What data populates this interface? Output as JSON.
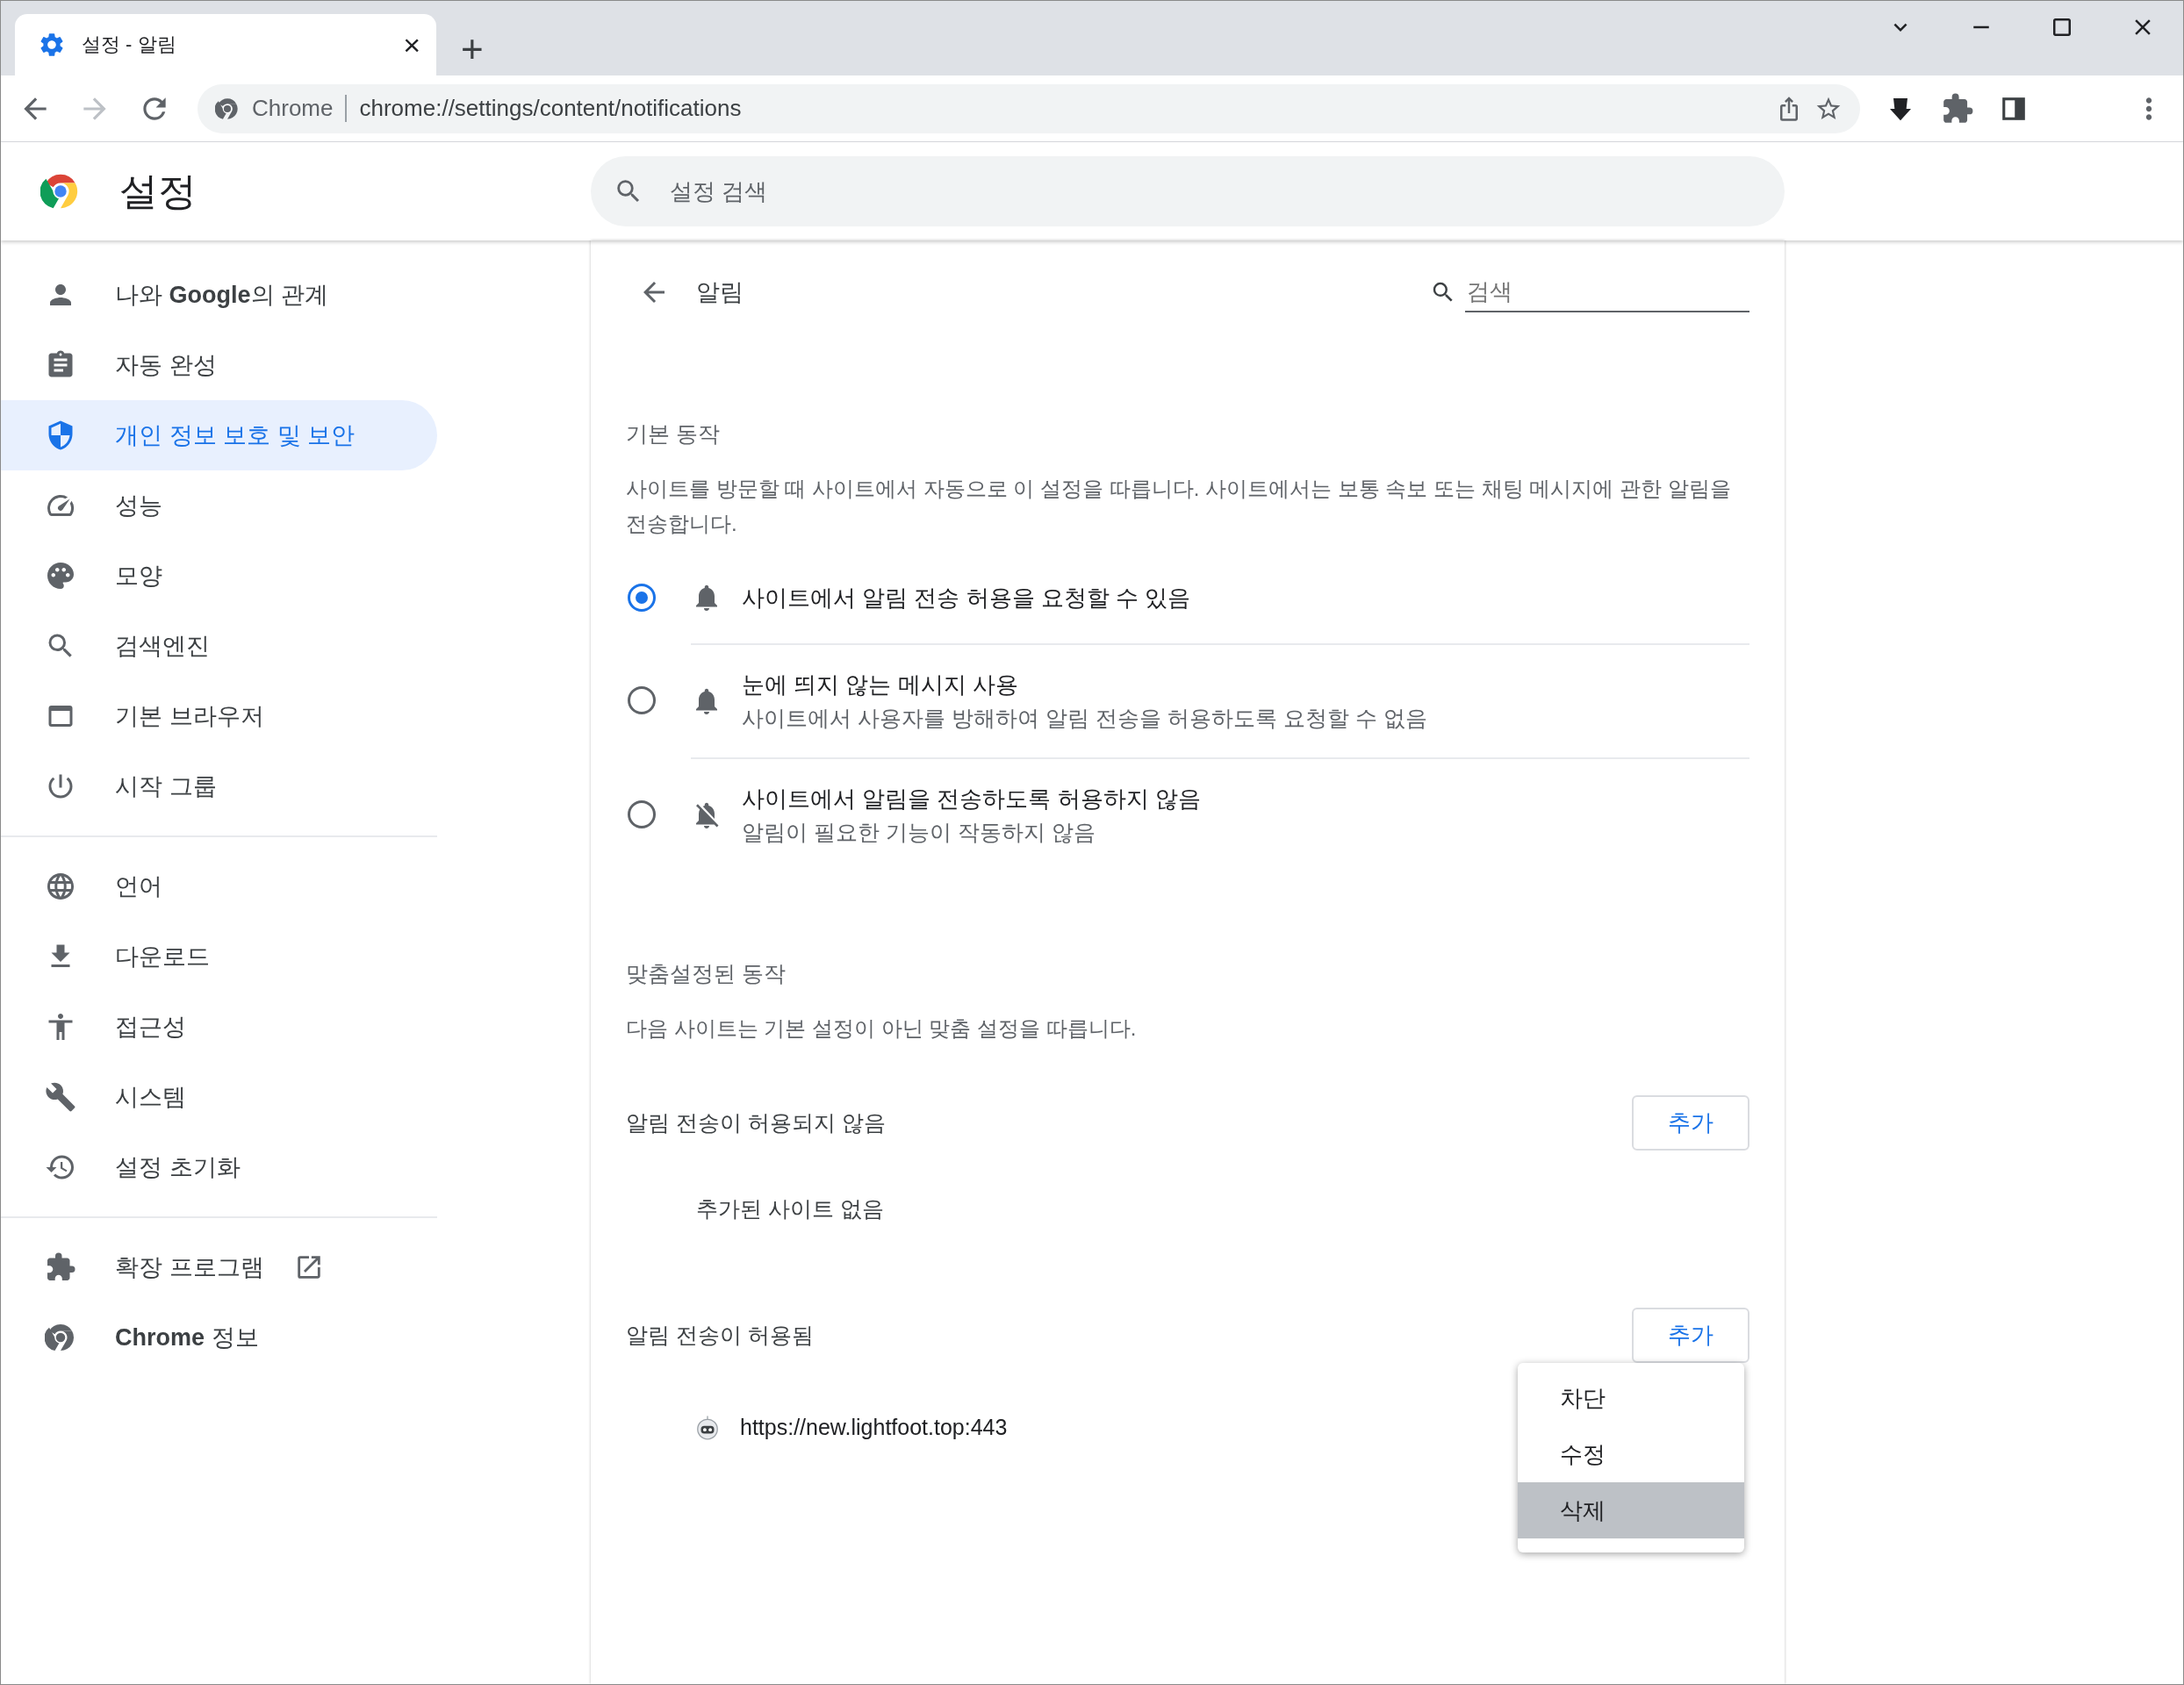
{
  "tab": {
    "title": "설정 - 알림",
    "close": "×",
    "new_tab": "+"
  },
  "omnibox": {
    "chip": "Chrome",
    "url": "chrome://settings/content/notifications"
  },
  "header": {
    "title": "설정",
    "search": {
      "placeholder": "설정 검색"
    }
  },
  "sidebar": {
    "sections": [
      [
        {
          "kind": "person",
          "label": "나와 **Google**의 관계",
          "selected": false
        },
        {
          "kind": "autofill",
          "label": "자동 완성",
          "selected": false
        },
        {
          "kind": "shield",
          "label": "개인 정보 보호 및 보안",
          "selected": true
        },
        {
          "kind": "speed",
          "label": "성능",
          "selected": false
        },
        {
          "kind": "palette",
          "label": "모양",
          "selected": false
        },
        {
          "kind": "search",
          "label": "검색엔진",
          "selected": false
        },
        {
          "kind": "browser",
          "label": "기본 브라우저",
          "selected": false
        },
        {
          "kind": "power",
          "label": "시작 그룹",
          "selected": false
        }
      ],
      [
        {
          "kind": "globe",
          "label": "언어",
          "selected": false
        },
        {
          "kind": "download",
          "label": "다운로드",
          "selected": false
        },
        {
          "kind": "accessibility",
          "label": "접근성",
          "selected": false
        },
        {
          "kind": "wrench",
          "label": "시스템",
          "selected": false
        },
        {
          "kind": "restore",
          "label": "설정 초기화",
          "selected": false
        }
      ],
      [
        {
          "kind": "extensions",
          "label": "확장 프로그램",
          "external": true,
          "selected": false
        },
        {
          "kind": "chrome",
          "label": "**Chrome** 정보",
          "selected": false
        }
      ]
    ]
  },
  "page": {
    "title": "알림",
    "search": {
      "placeholder": "검색"
    },
    "default_heading": "기본 동작",
    "default_description": "사이트를 방문할 때 사이트에서 자동으로 이 설정을 따릅니다. 사이트에서는 보통 속보 또는 채팅 메시지에 관한 알림을 전송합니다.",
    "options": [
      {
        "kind": "bell",
        "title": "사이트에서 알림 전송 허용을 요청할 수 있음",
        "selected": true
      },
      {
        "kind": "bell",
        "title": "눈에 띄지 않는 메시지 사용",
        "description": "사이트에서 사용자를 방해하여 알림 전송을 허용하도록 요청할 수 없음",
        "selected": false
      },
      {
        "kind": "bell-off",
        "title": "사이트에서 알림을 전송하도록 허용하지 않음",
        "description": "알림이 필요한 기능이 작동하지 않음",
        "selected": false
      }
    ],
    "custom_heading": "맞춤설정된 동작",
    "custom_description": "다음 사이트는 기본 설정이 아닌 맞춤 설정을 따릅니다.",
    "lists": [
      {
        "title": "알림 전송이 허용되지 않음",
        "button": "추가",
        "empty": "추가된 사이트 없음"
      },
      {
        "title": "알림 전송이 허용됨",
        "button": "추가",
        "sites": [
          {
            "url": "https://new.lightfoot.top:443"
          }
        ]
      }
    ],
    "menu": [
      {
        "label": "차단",
        "selected": false
      },
      {
        "label": "수정",
        "selected": false
      },
      {
        "label": "삭제",
        "selected": true
      }
    ]
  }
}
